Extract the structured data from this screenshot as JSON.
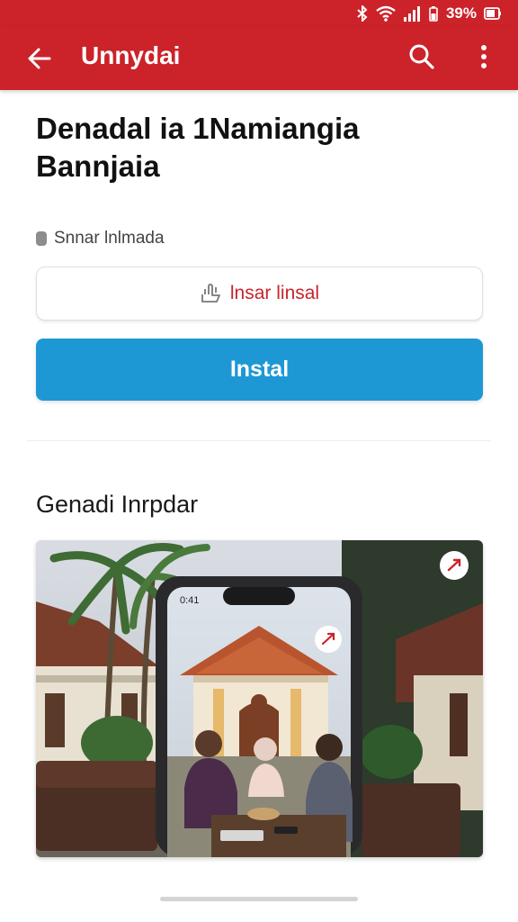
{
  "status_bar": {
    "battery_text": "39%"
  },
  "app_bar": {
    "title": "Unnydai"
  },
  "app": {
    "name_line1": "Denadal ia  1Namiangia",
    "name_line2": "Bannjaia",
    "meta": "Snnar lnlmada"
  },
  "buttons": {
    "secondary_label": "lnsar linsal",
    "install_label": "Instal"
  },
  "section": {
    "title": "Genadi Inrpdar"
  },
  "preview": {
    "phone_time": "0:41"
  },
  "colors": {
    "brand_red": "#cc2229",
    "install_blue": "#1e98d5"
  }
}
